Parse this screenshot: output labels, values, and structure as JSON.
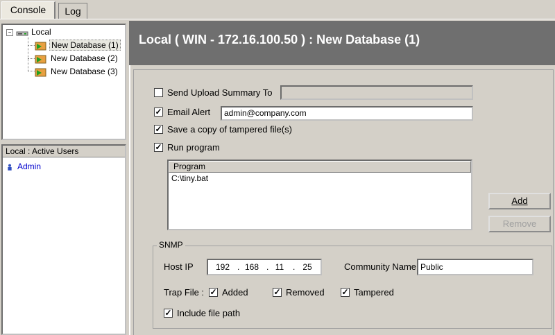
{
  "tabs": [
    {
      "label": "Console",
      "active": true
    },
    {
      "label": "Log",
      "active": false
    }
  ],
  "tree": {
    "root": "Local",
    "items": [
      "New Database (1)",
      "New Database (2)",
      "New Database (3)"
    ],
    "selected_index": 0
  },
  "users_pane": {
    "header": "Local : Active Users",
    "users": [
      "Admin"
    ]
  },
  "title": "Local ( WIN - 172.16.100.50 )  : New Database (1)",
  "options": {
    "send_upload_summary": {
      "label": "Send Upload Summary To",
      "checked": false,
      "value": ""
    },
    "email_alert": {
      "label": "Email Alert",
      "checked": true,
      "value": "admin@company.com"
    },
    "save_copy": {
      "label": "Save a copy of tampered file(s)",
      "checked": true
    },
    "run_program": {
      "label": "Run program",
      "checked": true
    }
  },
  "program_list": {
    "column": "Program",
    "rows": [
      "C:\\tiny.bat"
    ]
  },
  "buttons": {
    "add": "Add",
    "remove": "Remove"
  },
  "snmp": {
    "title": "SNMP",
    "host_ip_label": "Host IP",
    "host_ip": [
      "192",
      "168",
      "11",
      "25"
    ],
    "community_label": "Community Name",
    "community": "Public",
    "trap_label": "Trap File :",
    "trap_added": {
      "label": "Added",
      "checked": true
    },
    "trap_removed": {
      "label": "Removed",
      "checked": true
    },
    "trap_tampered": {
      "label": "Tampered",
      "checked": true
    },
    "include_path": {
      "label": "Include file path",
      "checked": true
    }
  },
  "colors": {
    "title_bar": "#6f6f6f",
    "window_bg": "#d4d0c8",
    "link_blue": "#0000cc"
  },
  "icons": [
    "computer-icon",
    "database-icon",
    "user-icon"
  ]
}
